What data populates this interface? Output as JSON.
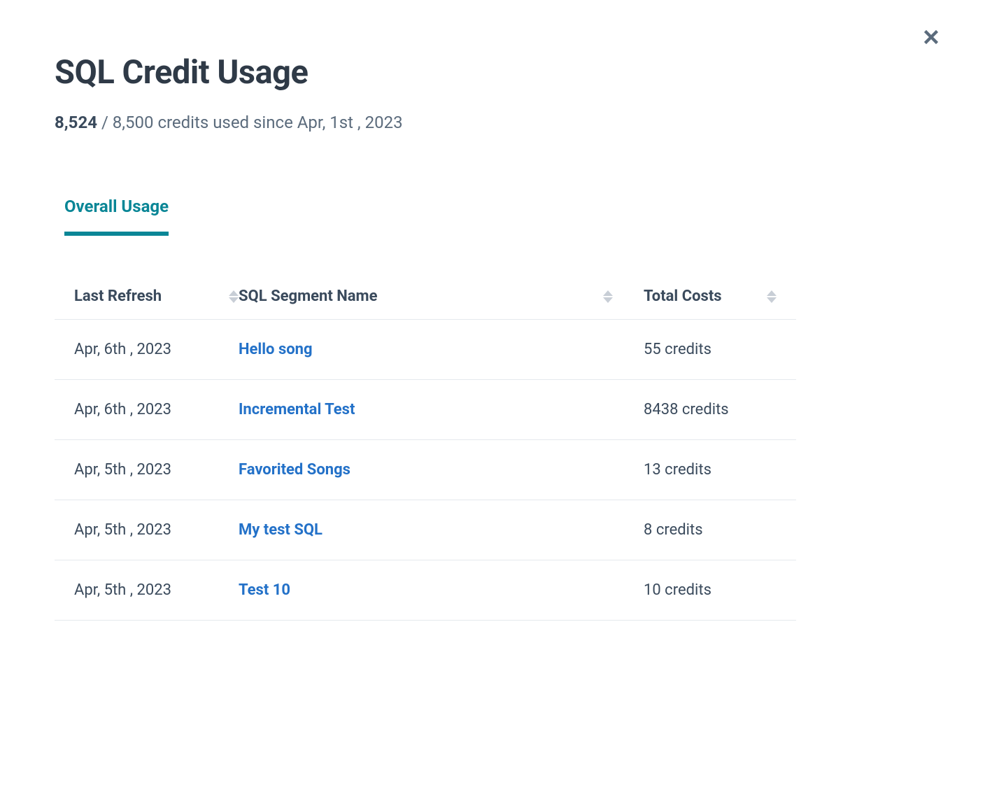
{
  "header": {
    "title": "SQL Credit Usage",
    "credits_used": "8,524",
    "credits_total": "8,500",
    "subtitle_middle": " / ",
    "subtitle_suffix": " credits used since Apr, 1st , 2023"
  },
  "tabs": {
    "overall": "Overall Usage"
  },
  "table": {
    "columns": {
      "refresh": "Last Refresh",
      "name": "SQL Segment Name",
      "cost": "Total Costs"
    },
    "rows": [
      {
        "refresh": "Apr, 6th , 2023",
        "name": "Hello song",
        "cost": "55 credits"
      },
      {
        "refresh": "Apr, 6th , 2023",
        "name": "Incremental Test",
        "cost": "8438 credits"
      },
      {
        "refresh": "Apr, 5th , 2023",
        "name": "Favorited Songs",
        "cost": "13 credits"
      },
      {
        "refresh": "Apr, 5th , 2023",
        "name": "My test SQL",
        "cost": "8 credits"
      },
      {
        "refresh": "Apr, 5th , 2023",
        "name": "Test 10",
        "cost": "10 credits"
      }
    ]
  }
}
